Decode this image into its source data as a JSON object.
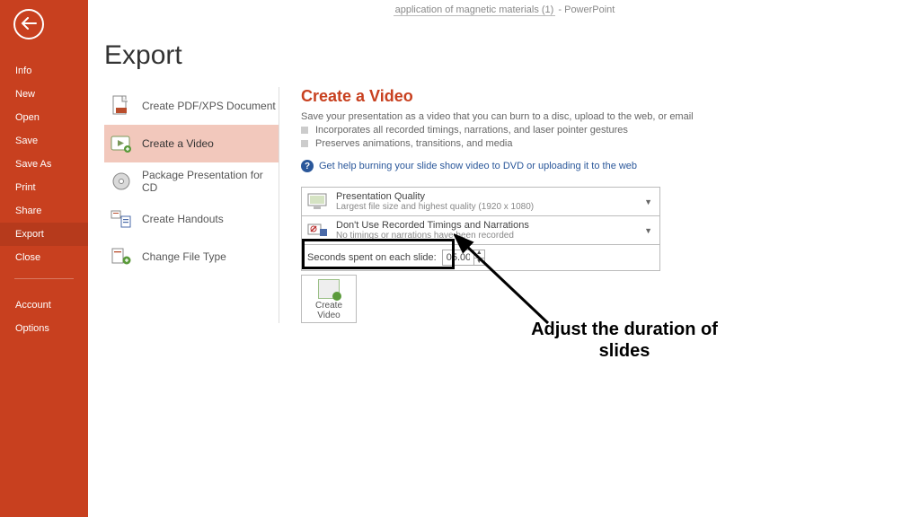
{
  "app_title_prefix": "application of magnetic materials (1)",
  "app_title_suffix": " - PowerPoint",
  "page_heading": "Export",
  "sidebar": {
    "items": [
      "Info",
      "New",
      "Open",
      "Save",
      "Save As",
      "Print",
      "Share",
      "Export",
      "Close"
    ],
    "selected_index": 7,
    "bottom_items": [
      "Account",
      "Options"
    ]
  },
  "export_options": {
    "items": [
      "Create PDF/XPS Document",
      "Create a Video",
      "Package Presentation for CD",
      "Create Handouts",
      "Change File Type"
    ],
    "selected_index": 1
  },
  "video": {
    "heading": "Create a Video",
    "subtitle": "Save your presentation as a video that you can burn to a disc, upload to the web, or email",
    "bullets": [
      "Incorporates all recorded timings, narrations, and laser pointer gestures",
      "Preserves animations, transitions, and media"
    ],
    "help_text": "Get help burning your slide show video to DVD or uploading it to the web",
    "quality_combo": {
      "title": "Presentation Quality",
      "sub": "Largest file size and highest quality (1920 x 1080)"
    },
    "timings_combo": {
      "title": "Don't Use Recorded Timings and Narrations",
      "sub": "No timings or narrations have been recorded"
    },
    "seconds_label": "Seconds spent on each slide:",
    "seconds_value": "05.00",
    "create_button_line1": "Create",
    "create_button_line2": "Video"
  },
  "annotation": "Adjust the duration of slides"
}
